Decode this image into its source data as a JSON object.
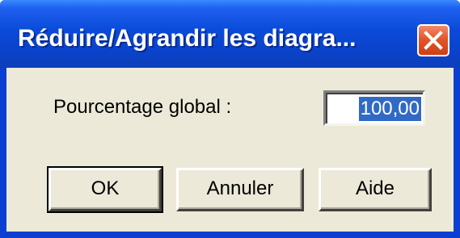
{
  "window": {
    "title": "Réduire/Agrandir les diagra...",
    "close_icon": "close-icon",
    "titlebar_color": "#0b4ad8",
    "close_button_color": "#e2562b",
    "body_color": "#ece9d8"
  },
  "form": {
    "label": "Pourcentage global :",
    "value": "100,00",
    "selection_color": "#316ac5"
  },
  "buttons": {
    "ok": "OK",
    "cancel": "Annuler",
    "help": "Aide"
  }
}
